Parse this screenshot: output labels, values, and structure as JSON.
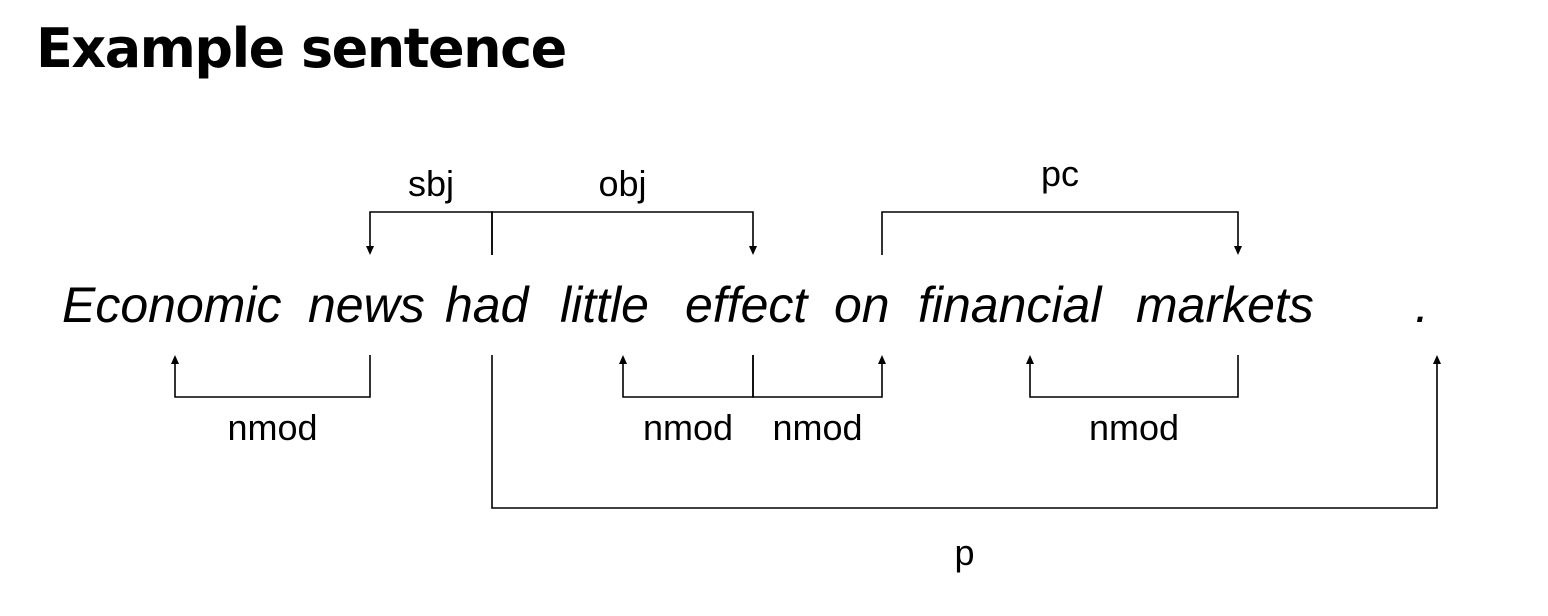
{
  "title": "Example sentence",
  "words": [
    "Economic",
    "news",
    "had",
    "little",
    "effect",
    "on",
    "financial",
    "markets",
    "."
  ],
  "relations": [
    {
      "label": "sbj",
      "head": 2,
      "dependent": 1,
      "side": "above",
      "level": 0
    },
    {
      "label": "obj",
      "head": 2,
      "dependent": 4,
      "side": "above",
      "level": 0
    },
    {
      "label": "pc",
      "head": 5,
      "dependent": 7,
      "side": "above",
      "level": 0
    },
    {
      "label": "nmod",
      "head": 1,
      "dependent": 0,
      "side": "below",
      "level": 0
    },
    {
      "label": "nmod",
      "head": 4,
      "dependent": 3,
      "side": "below",
      "level": 0
    },
    {
      "label": "nmod",
      "head": 4,
      "dependent": 5,
      "side": "below",
      "level": 0
    },
    {
      "label": "nmod",
      "head": 7,
      "dependent": 6,
      "side": "below",
      "level": 0
    },
    {
      "label": "p",
      "head": 2,
      "dependent": 8,
      "side": "below",
      "level": 1
    }
  ]
}
